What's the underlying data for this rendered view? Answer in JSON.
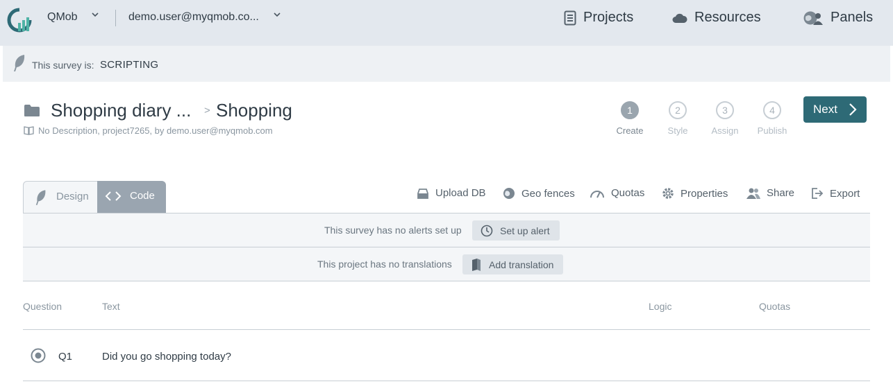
{
  "header": {
    "org": "QMob",
    "user": "demo.user@myqmob.co...",
    "nav": [
      {
        "label": "Projects",
        "icon": "document-icon"
      },
      {
        "label": "Resources",
        "icon": "cloud-icon"
      },
      {
        "label": "Panels",
        "icon": "people-globe-icon"
      }
    ]
  },
  "status": {
    "label": "This survey is:",
    "value": "SCRIPTING"
  },
  "survey": {
    "title": "Shopping diary ...",
    "separator": ">",
    "subtitle": "Shopping",
    "description": "No Description, project7265, by demo.user@myqmob.com"
  },
  "steps": [
    {
      "num": "1",
      "label": "Create",
      "active": true
    },
    {
      "num": "2",
      "label": "Style",
      "active": false
    },
    {
      "num": "3",
      "label": "Assign",
      "active": false
    },
    {
      "num": "4",
      "label": "Publish",
      "active": false
    }
  ],
  "next_label": "Next",
  "tabs": {
    "design": "Design",
    "code": "Code"
  },
  "toolbar": [
    {
      "label": "Upload DB",
      "icon": "upload-db-icon"
    },
    {
      "label": "Geo fences",
      "icon": "globe-icon"
    },
    {
      "label": "Quotas",
      "icon": "gauge-icon"
    },
    {
      "label": "Properties",
      "icon": "gear-icon"
    },
    {
      "label": "Share",
      "icon": "users-icon"
    },
    {
      "label": "Export",
      "icon": "export-icon"
    }
  ],
  "alerts": {
    "message": "This survey has no alerts set up",
    "button": "Set up alert"
  },
  "translations": {
    "message": "This project has no translations",
    "button": "Add translation"
  },
  "table": {
    "headers": {
      "question": "Question",
      "text": "Text",
      "logic": "Logic",
      "quotas": "Quotas"
    },
    "rows": [
      {
        "id": "Q1",
        "text": "Did you go shopping today?"
      }
    ]
  },
  "colors": {
    "primary": "#2e6a76",
    "topbar": "#e3e8ee",
    "tab_active": "#9aa5b0"
  }
}
